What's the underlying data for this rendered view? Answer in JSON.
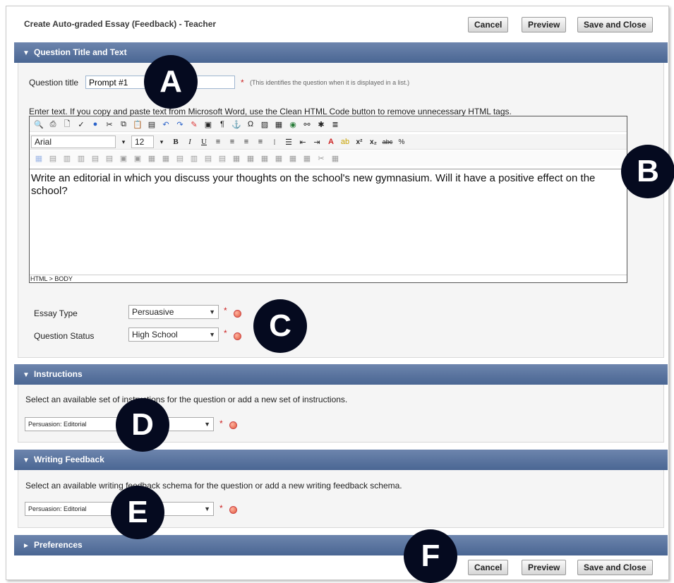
{
  "header": {
    "title": "Create Auto-graded Essay (Feedback) - Teacher",
    "cancel": "Cancel",
    "preview": "Preview",
    "save_close": "Save and Close"
  },
  "sections": {
    "question": {
      "title": "Question Title and Text",
      "title_label": "Question title",
      "title_value": "Prompt #1",
      "title_hint": "(This identifies the question when it is displayed in a list.)",
      "instructions": "Enter text. If you copy and paste text from Microsoft Word, use the Clean HTML Code button to remove unnecessary HTML tags.",
      "font_name": "Arial",
      "font_size": "12",
      "body_text": "Write an editorial in which you discuss your thoughts on the school's new gymnasium. Will it have a positive effect on the school?",
      "status_path": "HTML > BODY",
      "essay_type_label": "Essay Type",
      "essay_type_value": "Persuasive",
      "question_status_label": "Question Status",
      "question_status_value": "High School"
    },
    "instructions": {
      "title": "Instructions",
      "text": "Select an available set of instructions for the question or add a new set of instructions.",
      "select_value": "Persuasion: Editorial"
    },
    "writing_feedback": {
      "title": "Writing Feedback",
      "text": "Select an available writing feedback schema for the question or add a new writing feedback schema.",
      "select_value": "Persuasion: Editorial"
    },
    "preferences": {
      "title": "Preferences"
    }
  },
  "required_mark": "*",
  "badges": [
    "A",
    "B",
    "C",
    "D",
    "E",
    "F"
  ],
  "colors": {
    "section_header": "#4a6693",
    "badge_bg": "#050a1f",
    "required": "#cc2222"
  },
  "icons": {
    "expanded": "triangle-down-icon",
    "collapsed": "triangle-right-icon"
  }
}
